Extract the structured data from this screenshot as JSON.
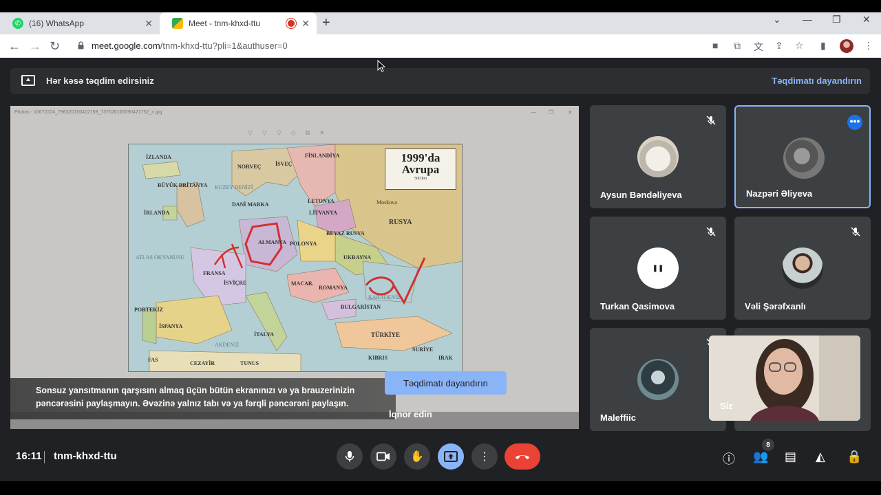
{
  "browser": {
    "tabs": [
      {
        "title": "(16) WhatsApp"
      },
      {
        "title": "Meet - tnm-khxd-ttu"
      }
    ],
    "url_host": "meet.google.com",
    "url_path": "/tnm-khxd-ttu?pli=1&authuser=0"
  },
  "banner": {
    "text": "Hər kəsə təqdim edirsiniz",
    "stop_label": "Təqdimatı dayandırın"
  },
  "shared_screen": {
    "window_title": "Photos - 10672224_796320150412159_737020100090421752_n.jpg",
    "map": {
      "title_line1": "1999'da",
      "title_line2": "Avrupa",
      "scale": "500 km",
      "labels": {
        "izlanda": "İZLANDA",
        "norvec": "NORVEÇ",
        "isvec": "İSVEÇ",
        "finlandiya": "FİNLANDİYA",
        "buyuk_britanya": "BÜYÜK BRİTANYA",
        "kuzey_denizi": "KUZEY DENİZİ",
        "dani_marka": "DANİ MARKA",
        "irlanda": "İRLANDA",
        "letonya": "LETONYA",
        "litvanya": "LİTVANYA",
        "rusya": "RUSYA",
        "moskova": "Moskova",
        "beyaz_rusya": "BEYAZ RUSYA",
        "almanya": "ALMANYA",
        "polonya": "POLONYA",
        "atlas_okyanusu": "ATLAS OKYANUSU",
        "ukrayna": "UKRAYNA",
        "fransa": "FRANSA",
        "isvicre": "İSVİÇRE",
        "macar": "MACAR.",
        "romanya": "ROMANYA",
        "karadeniz": "KARADENİZ",
        "portekiz": "PORTEKİZ",
        "ispanya": "İSPANYA",
        "italya": "İTALYA",
        "bulgaristan": "BULGARİSTAN",
        "turkiye": "TÜRKİYE",
        "akdeniz": "AKDENİZ",
        "fas": "FAS",
        "cezayir": "CEZAYİR",
        "tunus": "TUNUS",
        "kibris": "KIBRIS",
        "suriye": "SURİYE",
        "irak": "IRAK"
      }
    },
    "warning": "Sonsuz yansıtmanın qarşısını almaq üçün bütün ekranınızı və ya brauzerinizin pəncərəsini paylaşmayın. Əvəzinə yalnız tabı və ya fərqli pəncərəni paylaşın.",
    "stop_button": "Təqdimatı dayandırın",
    "ignore_label": "İqnor edin"
  },
  "participants": [
    {
      "name": "Aysun Bəndəliyeva",
      "muted": true
    },
    {
      "name": "Nazpəri Əliyeva",
      "muted": false,
      "active": true
    },
    {
      "name": "Turkan Qasimova",
      "muted": true
    },
    {
      "name": "Vəli Şərəfxanlı",
      "muted": true
    },
    {
      "name": "Maleffiic",
      "muted": true
    }
  ],
  "self_view": {
    "label": "Siz"
  },
  "bottom": {
    "time": "16:11",
    "meeting_code": "tnm-khxd-ttu",
    "people_count": "8"
  },
  "colors": {
    "accent": "#8ab4f8",
    "hangup": "#ea4335",
    "background": "#202124",
    "tile": "#3c4043"
  }
}
